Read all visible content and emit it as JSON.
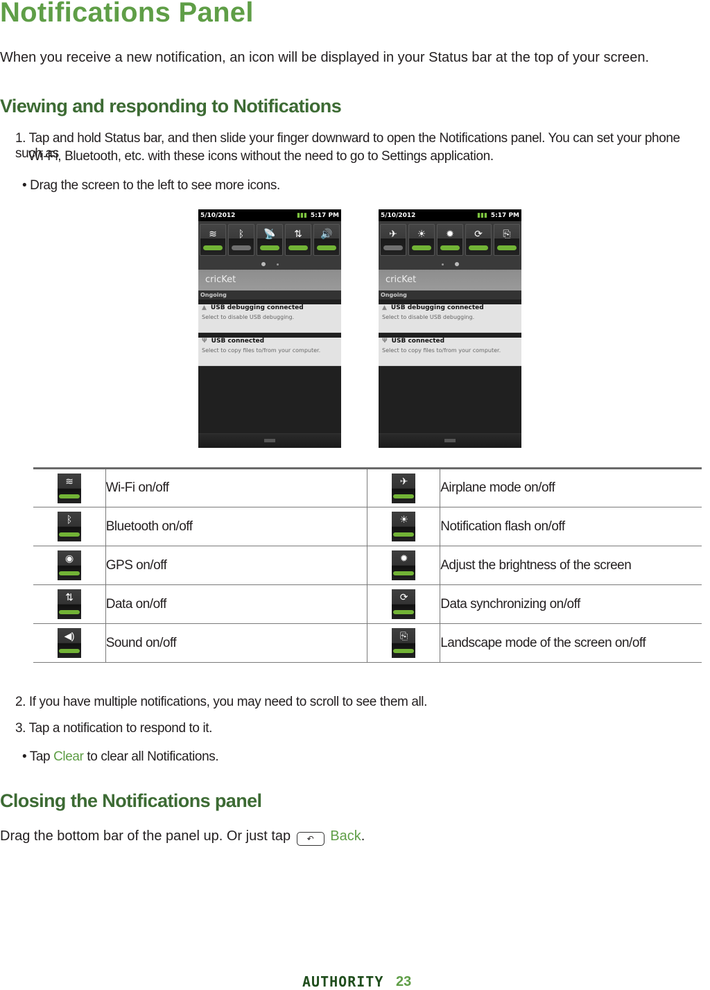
{
  "title": "Notifications Panel",
  "intro": "When you receive a new notification, an icon will be displayed in your Status bar at the top of your screen.",
  "section1": {
    "heading": "Viewing and responding to Notifications",
    "step1_line1": "1. Tap and hold Status bar, and then slide your finger downward to open the Notifications panel. You can set your phone such as",
    "step1_line2": "Wi-Fi, Bluetooth, etc. with these icons without the need to go to Settings application.",
    "bullet1": "• Drag the screen to the left to see more icons."
  },
  "phones": [
    {
      "date": "5/10/2012",
      "time": "5:17 PM",
      "toggles": [
        {
          "icon": "wifi-icon",
          "glyph": "≋",
          "state": "on"
        },
        {
          "icon": "bluetooth-icon",
          "glyph": "ᛒ",
          "state": "off"
        },
        {
          "icon": "gps-icon",
          "glyph": "📡",
          "state": "on"
        },
        {
          "icon": "data-icon",
          "glyph": "⇅",
          "state": "on"
        },
        {
          "icon": "sound-icon",
          "glyph": "🔊",
          "state": "on"
        }
      ],
      "page": 1,
      "carrier": "cricKet",
      "ongoing_label": "Ongoing",
      "notifications": [
        {
          "title": "USB debugging connected",
          "subtitle": "Select to disable USB debugging."
        },
        {
          "title": "USB connected",
          "subtitle": "Select to copy files to/from your computer."
        }
      ]
    },
    {
      "date": "5/10/2012",
      "time": "5:17 PM",
      "toggles": [
        {
          "icon": "airplane-icon",
          "glyph": "✈",
          "state": "off"
        },
        {
          "icon": "notification-flash-icon",
          "glyph": "☀",
          "state": "on"
        },
        {
          "icon": "brightness-icon",
          "glyph": "✹",
          "state": "on"
        },
        {
          "icon": "sync-icon",
          "glyph": "⟳",
          "state": "on"
        },
        {
          "icon": "rotate-icon",
          "glyph": "⎘",
          "state": "on"
        }
      ],
      "page": 2,
      "carrier": "cricKet",
      "ongoing_label": "Ongoing",
      "notifications": [
        {
          "title": "USB debugging connected",
          "subtitle": "Select to disable USB debugging."
        },
        {
          "title": "USB connected",
          "subtitle": "Select to copy files to/from your computer."
        }
      ]
    }
  ],
  "icon_table": [
    {
      "left_icon": "wifi-icon",
      "left_glyph": "≋",
      "left_label": "Wi-Fi on/off",
      "right_icon": "airplane-icon",
      "right_glyph": "✈",
      "right_label": "Airplane mode on/off"
    },
    {
      "left_icon": "bluetooth-icon",
      "left_glyph": "ᛒ",
      "left_label": "Bluetooth on/off",
      "right_icon": "notification-flash-icon",
      "right_glyph": "☀",
      "right_label": "Notification flash on/off"
    },
    {
      "left_icon": "gps-icon",
      "left_glyph": "◉",
      "left_label": "GPS on/off",
      "right_icon": "brightness-icon",
      "right_glyph": "✹",
      "right_label": "Adjust the brightness of the screen"
    },
    {
      "left_icon": "data-icon",
      "left_glyph": "⇅",
      "left_label": "Data on/off",
      "right_icon": "sync-icon",
      "right_glyph": "⟳",
      "right_label": "Data synchronizing on/off"
    },
    {
      "left_icon": "sound-icon",
      "left_glyph": "◀)",
      "left_label": "Sound on/off",
      "right_icon": "rotate-icon",
      "right_glyph": "⎘",
      "right_label": "Landscape mode of the screen on/off"
    }
  ],
  "section1b": {
    "step2": "2. If you have multiple notifications, you may need to scroll to see them all.",
    "step3": "3. Tap a notification to respond to it.",
    "bullet2_pre": "• Tap ",
    "bullet2_link": "Clear",
    "bullet2_post": " to clear all Notifications."
  },
  "section2": {
    "heading": "Closing the Notifications panel",
    "text_pre": "Drag the bottom bar of the panel up. Or just tap",
    "back_key_glyph": "↶",
    "back_label": "Back",
    "text_post": "."
  },
  "footer": {
    "brand": "AUTHORITY",
    "page_number": "23"
  }
}
